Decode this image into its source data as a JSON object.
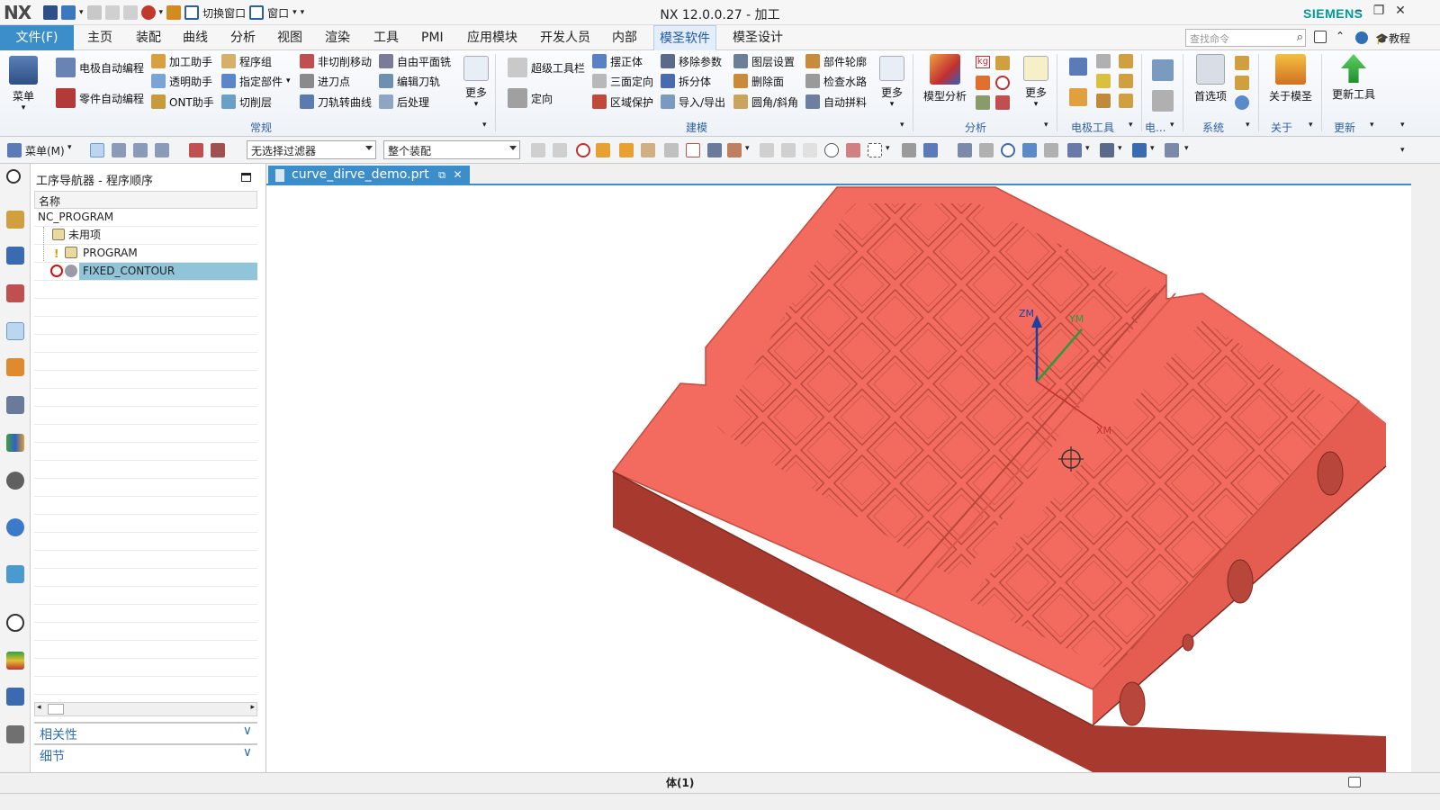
{
  "app": {
    "logo": "NX",
    "title": "NX 12.0.0.27 - 加工",
    "brand": "SIEMENS",
    "quick_access": {
      "switch_window": "切换窗口",
      "window": "窗口"
    }
  },
  "menu": {
    "file": "文件(F)",
    "tabs": [
      "主页",
      "装配",
      "曲线",
      "分析",
      "视图",
      "渲染",
      "工具",
      "PMI",
      "应用模块",
      "开发人员",
      "内部",
      "模圣软件",
      "模圣设计"
    ],
    "active_tab": "模圣软件",
    "search_placeholder": "查找命令",
    "tutorial": "教程"
  },
  "ribbon": {
    "menu_label": "菜单",
    "general": {
      "items": [
        "电极自动编程",
        "零件自动编程",
        "加工助手",
        "透明助手",
        "ONT助手",
        "程序组",
        "指定部件",
        "切削层",
        "非切削移动",
        "进刀点",
        "刀轨转曲线",
        "自由平面铣",
        "编辑刀轨",
        "后处理"
      ],
      "more": "更多",
      "label": "常规"
    },
    "modeling": {
      "items": [
        "超级工具栏",
        "定向",
        "摆正体",
        "三面定向",
        "区域保护",
        "移除参数",
        "拆分体",
        "导入/导出",
        "图层设置",
        "删除面",
        "圆角/斜角",
        "部件轮廓",
        "检查水路",
        "自动拼料"
      ],
      "more": "更多",
      "label": "建模"
    },
    "analysis": {
      "model_analysis": "模型分析",
      "kg": "kg",
      "more": "更多",
      "label": "分析"
    },
    "electrode": {
      "label": "电极工具"
    },
    "elec_short": {
      "label": "电..."
    },
    "system": {
      "prefs": "首选项",
      "label": "系统"
    },
    "about": {
      "about": "关于模圣",
      "label": "关于"
    },
    "update": {
      "update": "更新工具",
      "label": "更新"
    }
  },
  "toolbar2": {
    "menu": "菜单(M)",
    "filter": "无选择过滤器",
    "assembly": "整个装配"
  },
  "navigator": {
    "title": "工序导航器 - 程序顺序",
    "column": "名称",
    "rows": [
      {
        "label": "NC_PROGRAM",
        "indent": 0
      },
      {
        "label": "未用项",
        "indent": 1
      },
      {
        "label": "PROGRAM",
        "indent": 1
      },
      {
        "label": "FIXED_CONTOUR",
        "indent": 1,
        "selected": true
      }
    ],
    "panels": [
      "相关性",
      "细节"
    ]
  },
  "document": {
    "tab": "curve_dirve_demo.prt"
  },
  "viewport": {
    "axes": {
      "z": "ZM",
      "y": "YM",
      "x": "XM"
    }
  },
  "status": {
    "text": "体(1)"
  },
  "colors": {
    "accent": "#3b8ec9",
    "part": "#f26b5e",
    "part_dark": "#b33a30",
    "selection": "#90c4d9",
    "brand": "#009999"
  }
}
